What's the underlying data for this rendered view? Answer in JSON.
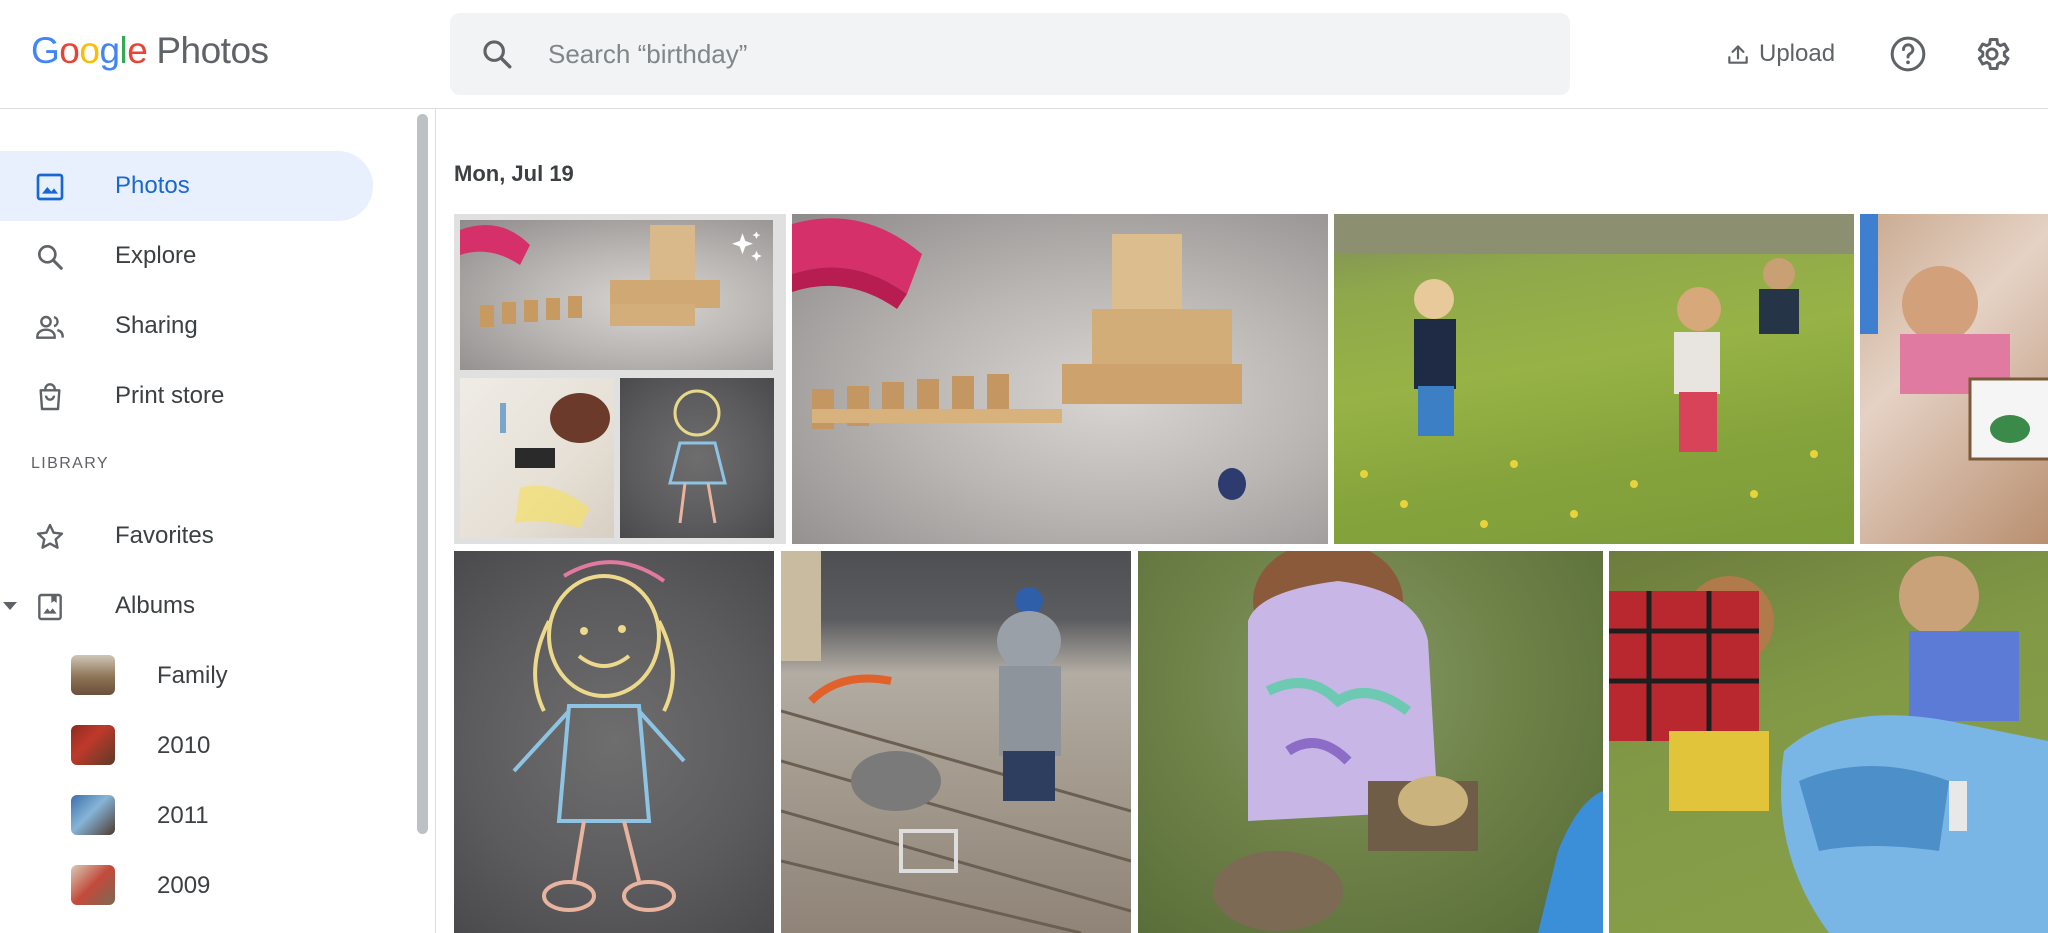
{
  "app": {
    "logo_letters": [
      "G",
      "o",
      "o",
      "g",
      "l",
      "e"
    ],
    "product_name": "Photos"
  },
  "search": {
    "placeholder": "Search “birthday”",
    "value": ""
  },
  "header_actions": {
    "upload_label": "Upload",
    "help_icon": "help-circle-icon",
    "settings_icon": "gear-icon"
  },
  "sidebar": {
    "nav": [
      {
        "label": "Photos",
        "icon": "photo-icon",
        "active": true
      },
      {
        "label": "Explore",
        "icon": "search-icon",
        "active": false
      },
      {
        "label": "Sharing",
        "icon": "people-icon",
        "active": false
      },
      {
        "label": "Print store",
        "icon": "shopping-bag-icon",
        "active": false
      }
    ],
    "library_label": "LIBRARY",
    "library": [
      {
        "label": "Favorites",
        "icon": "star-icon"
      },
      {
        "label": "Albums",
        "icon": "album-icon",
        "expanded": true
      }
    ],
    "albums": [
      {
        "label": "Family"
      },
      {
        "label": "2010"
      },
      {
        "label": "2011"
      },
      {
        "label": "2009"
      }
    ]
  },
  "main": {
    "date_heading": "Mon, Jul 19",
    "photos": [
      {
        "subject": "collage-blocks-and-chalk",
        "badge_icon": "sparkle-icon"
      },
      {
        "subject": "wooden-blocks-on-floor"
      },
      {
        "subject": "toddlers-in-grass"
      },
      {
        "subject": "toddler-sitting-on-floor"
      },
      {
        "subject": "chalk-drawing"
      },
      {
        "subject": "toddler-on-deck"
      },
      {
        "subject": "toddler-in-mud"
      },
      {
        "subject": "kids-at-water-table"
      }
    ]
  }
}
